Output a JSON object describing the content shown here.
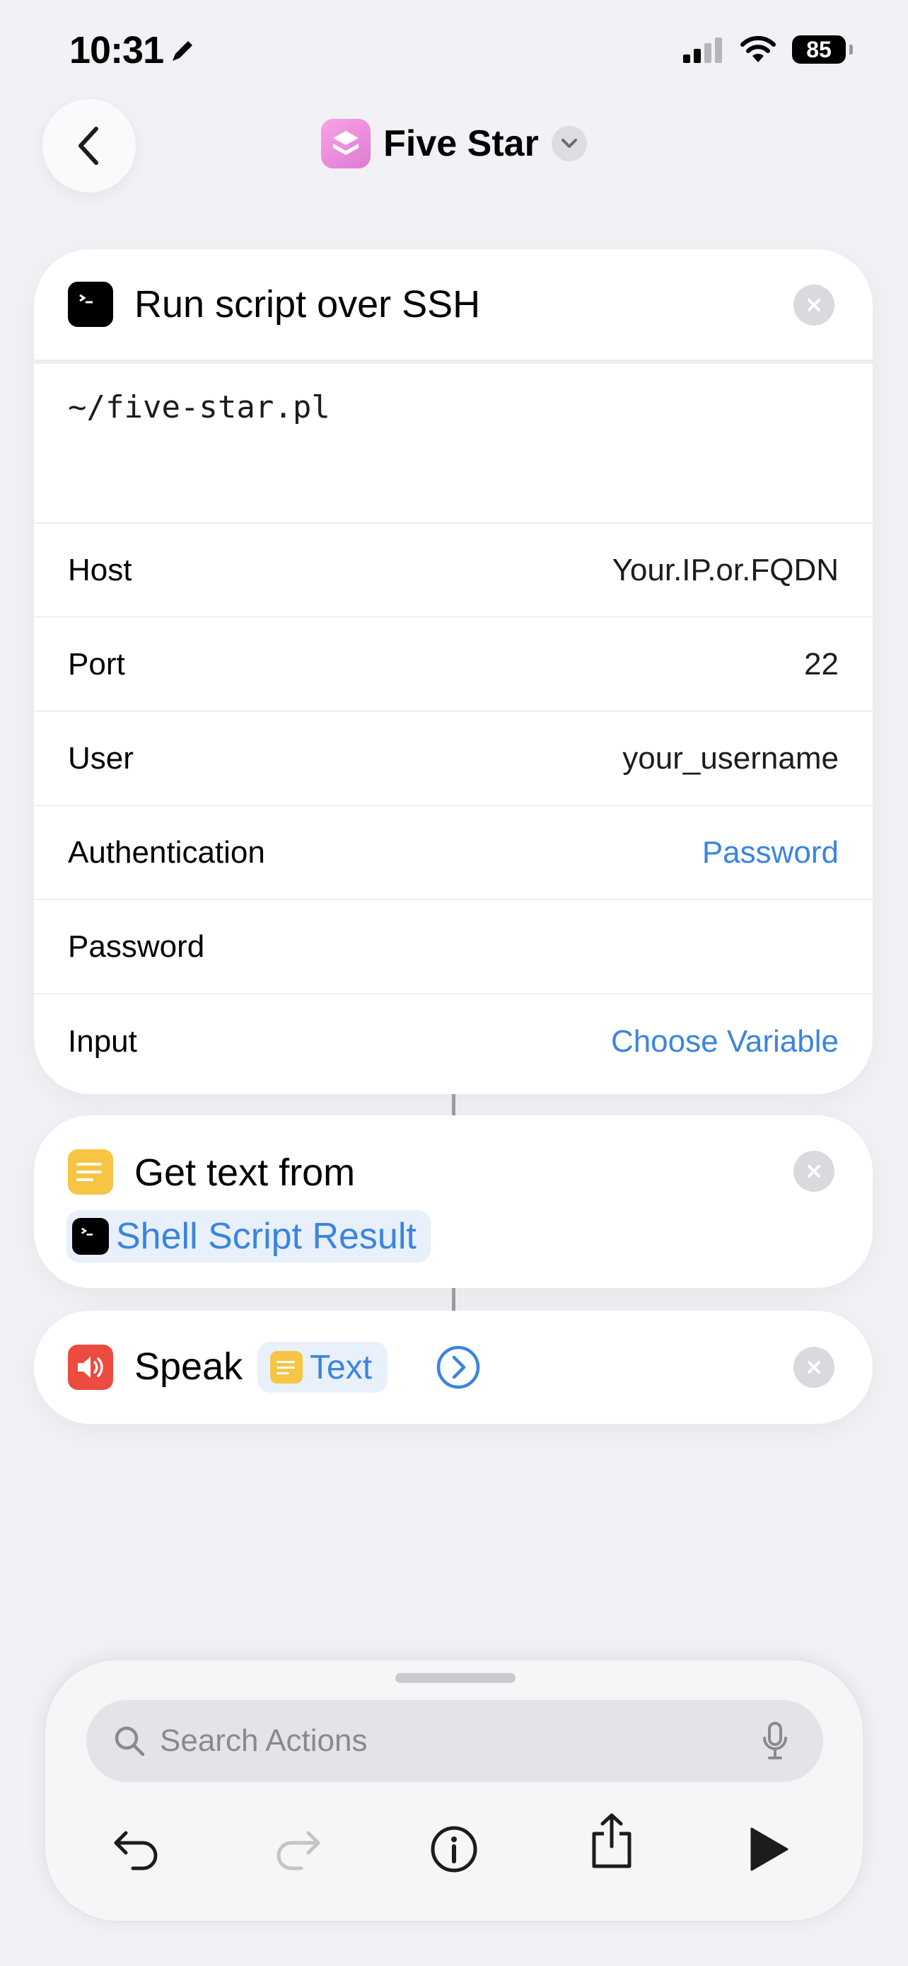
{
  "status_bar": {
    "time": "10:31",
    "battery": "85"
  },
  "nav": {
    "title": "Five Star"
  },
  "ssh_action": {
    "title": "Run script over SSH",
    "script": "~/five-star.pl",
    "rows": [
      {
        "label": "Host",
        "value": "Your.IP.or.FQDN",
        "link": false
      },
      {
        "label": "Port",
        "value": "22",
        "link": false
      },
      {
        "label": "User",
        "value": "your_username",
        "link": false
      },
      {
        "label": "Authentication",
        "value": "Password",
        "link": true
      },
      {
        "label": "Password",
        "value": "",
        "link": false
      },
      {
        "label": "Input",
        "value": "Choose Variable",
        "link": true
      }
    ]
  },
  "get_text_action": {
    "title": "Get text from",
    "variable": "Shell Script Result"
  },
  "speak_action": {
    "title": "Speak",
    "variable": "Text"
  },
  "bottom_panel": {
    "search_placeholder": "Search Actions"
  },
  "colors": {
    "accent": "#3b84e0",
    "background": "#f1f1f6",
    "notes": "#f7c443",
    "speaker": "#ec4b40",
    "app_icon": "#e98cdc"
  },
  "icons": [
    "back-chevron-icon",
    "app-layers-icon",
    "chevron-down-icon",
    "terminal-icon",
    "close-icon",
    "notes-icon",
    "speaker-icon",
    "chevron-right-circle-icon",
    "search-icon",
    "mic-icon",
    "undo-icon",
    "redo-icon",
    "info-icon",
    "share-icon",
    "play-icon"
  ]
}
